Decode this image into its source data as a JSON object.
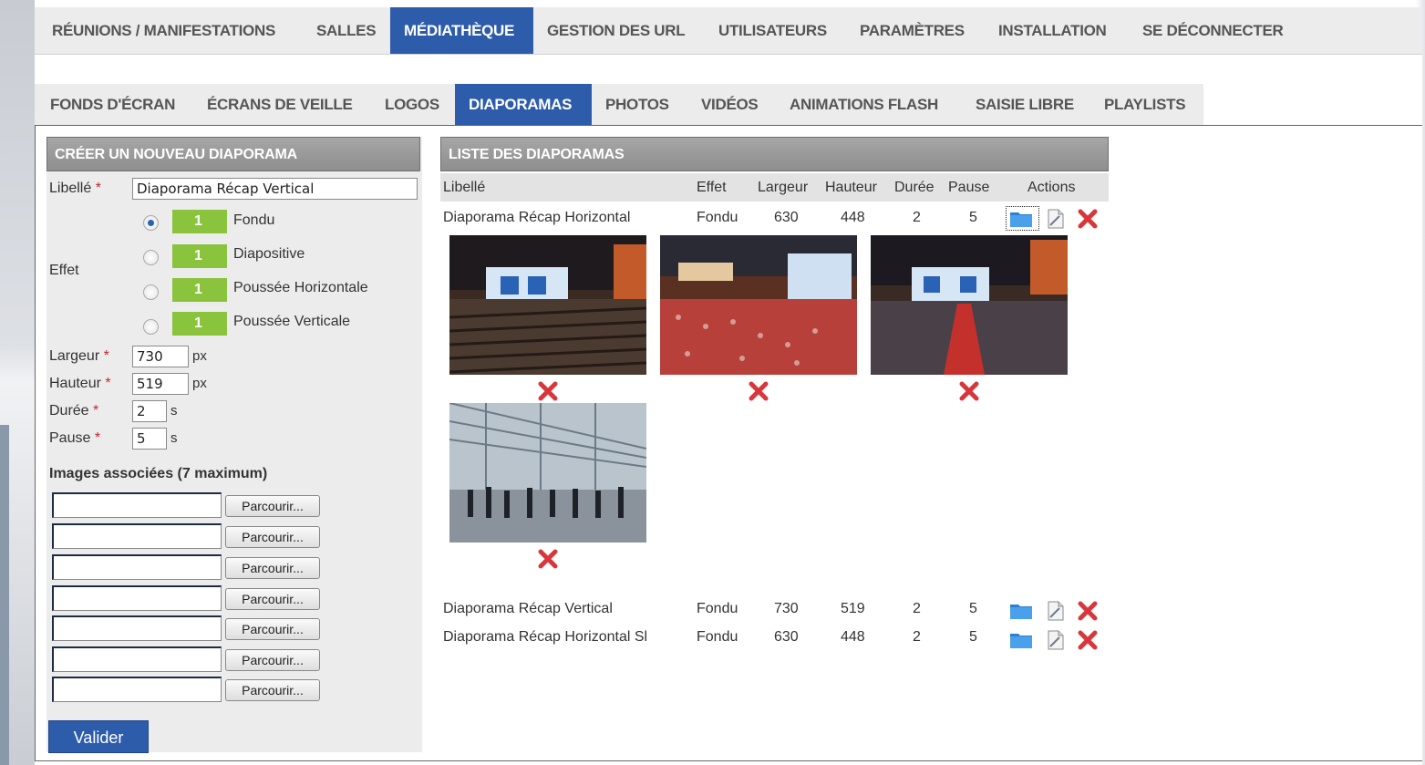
{
  "topnav": {
    "items": [
      "RÉUNIONS / MANIFESTATIONS",
      "SALLES",
      "MÉDIATHÈQUE",
      "GESTION DES URL",
      "UTILISATEURS",
      "PARAMÈTRES",
      "INSTALLATION",
      "SE DÉCONNECTER"
    ],
    "active_index": 2
  },
  "subnav": {
    "items": [
      "FONDS D'ÉCRAN",
      "ÉCRANS DE VEILLE",
      "LOGOS",
      "DIAPORAMAS",
      "PHOTOS",
      "VIDÉOS",
      "ANIMATIONS FLASH",
      "SAISIE LIBRE",
      "PLAYLISTS"
    ],
    "active_index": 3
  },
  "form": {
    "title": "CRÉER UN NOUVEAU DIAPORAMA",
    "libelle_label": "Libellé",
    "libelle_value": "Diaporama Récap Vertical",
    "required_mark": "*",
    "effet_label": "Effet",
    "effects": [
      {
        "name": "Fondu",
        "badge": "1",
        "selected": true
      },
      {
        "name": "Diapositive",
        "badge": "1",
        "selected": false
      },
      {
        "name": "Poussée Horizontale",
        "badge": "1",
        "selected": false
      },
      {
        "name": "Poussée Verticale",
        "badge": "1",
        "selected": false
      }
    ],
    "largeur_label": "Largeur",
    "largeur_value": "730",
    "hauteur_label": "Hauteur",
    "hauteur_value": "519",
    "duree_label": "Durée",
    "duree_value": "2",
    "pause_label": "Pause",
    "pause_value": "5",
    "unit_px": "px",
    "unit_s": "s",
    "images_label": "Images associées (7 maximum)",
    "browse_label": "Parcourir...",
    "file_inputs": 7,
    "submit_label": "Valider"
  },
  "list": {
    "title": "LISTE DES DIAPORAMAS",
    "columns": [
      "Libellé",
      "Effet",
      "Largeur",
      "Hauteur",
      "Durée",
      "Pause",
      "Actions"
    ],
    "rows": [
      {
        "libelle": "Diaporama Récap Horizontal",
        "effet": "Fondu",
        "largeur": "630",
        "hauteur": "448",
        "duree": "2",
        "pause": "5",
        "expanded": true
      },
      {
        "libelle": "Diaporama Récap Vertical",
        "effet": "Fondu",
        "largeur": "730",
        "hauteur": "519",
        "duree": "2",
        "pause": "5",
        "expanded": false
      },
      {
        "libelle": "Diaporama Récap Horizontal Sl",
        "effet": "Fondu",
        "largeur": "630",
        "hauteur": "448",
        "duree": "2",
        "pause": "5",
        "expanded": false
      }
    ],
    "thumbnails": [
      "auditorium-stage-photo",
      "conference-crowd-photo",
      "auditorium-aisle-photo",
      "atrium-crowd-photo"
    ]
  },
  "colors": {
    "accent_blue": "#2d5cab",
    "badge_green": "#8ac33c",
    "delete_red": "#d9363c",
    "header_gray": "#999999"
  }
}
